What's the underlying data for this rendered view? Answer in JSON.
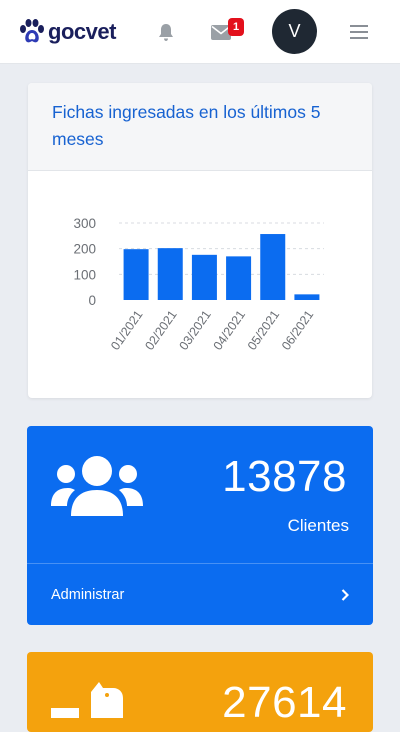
{
  "brand": {
    "name": "gocvet",
    "logo_icon": "paw-icon"
  },
  "navbar": {
    "notifications_icon": "bell-icon",
    "messages_icon": "envelope-icon",
    "messages_badge": "1",
    "avatar_initial": "V",
    "menu_icon": "hamburger-icon"
  },
  "chart_card": {
    "title": "Fichas ingresadas en los últimos 5 meses"
  },
  "chart_data": {
    "type": "bar",
    "categories": [
      "01/2021",
      "02/2021",
      "03/2021",
      "04/2021",
      "05/2021",
      "06/2021"
    ],
    "values": [
      198,
      202,
      176,
      170,
      257,
      22
    ],
    "ylim": [
      0,
      300
    ],
    "yticks": [
      "0",
      "100",
      "200",
      "300"
    ],
    "grid": true,
    "color": "#0b6cf0"
  },
  "stats": [
    {
      "number": "13878",
      "label": "Clientes",
      "footer": "Administrar",
      "icon": "users-icon",
      "color": "#0b6cf0"
    },
    {
      "number": "27614",
      "icon": "dog-icon",
      "color": "#f4a20d"
    }
  ]
}
